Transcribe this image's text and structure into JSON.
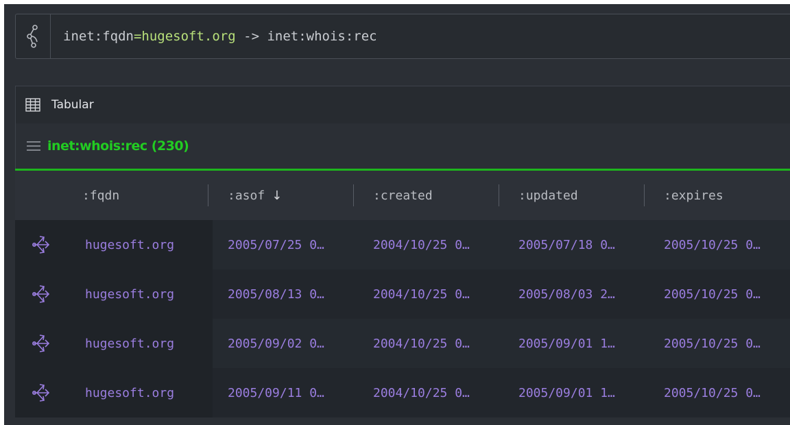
{
  "query": {
    "prop": "inet:fqdn",
    "eq": "=",
    "value": "hugesoft.org",
    "op": " -> ",
    "target": "inet:whois:rec"
  },
  "panel": {
    "title": "Tabular",
    "form_title": "inet:whois:rec (230)"
  },
  "table": {
    "columns": [
      ":fqdn",
      ":asof",
      ":created",
      ":updated",
      ":expires"
    ],
    "sort_indicator": "↓",
    "rows": [
      {
        "fqdn": "hugesoft.org",
        "asof": "2005/07/25 0…",
        "created": "2004/10/25 0…",
        "updated": "2005/07/18 0…",
        "expires": "2005/10/25 0…"
      },
      {
        "fqdn": "hugesoft.org",
        "asof": "2005/08/13 0…",
        "created": "2004/10/25 0…",
        "updated": "2005/08/03 2…",
        "expires": "2005/10/25 0…"
      },
      {
        "fqdn": "hugesoft.org",
        "asof": "2005/09/02 0…",
        "created": "2004/10/25 0…",
        "updated": "2005/09/01 1…",
        "expires": "2005/10/25 0…"
      },
      {
        "fqdn": "hugesoft.org",
        "asof": "2005/09/11 0…",
        "created": "2004/10/25 0…",
        "updated": "2005/09/01 1…",
        "expires": "2005/10/25 0…"
      }
    ]
  },
  "colors": {
    "accent_green": "#22cc22",
    "value_purple": "#9b7ee0",
    "query_value": "#b8e07a"
  },
  "icons": {
    "query": "storm-query-icon",
    "tabular": "table-grid-icon",
    "form_menu": "menu-icon",
    "row_action": "pivot-arrows-icon"
  }
}
